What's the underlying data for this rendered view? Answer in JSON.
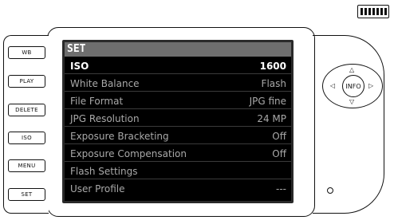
{
  "side_buttons": [
    {
      "label": "WB"
    },
    {
      "label": "PLAY"
    },
    {
      "label": "DELETE"
    },
    {
      "label": "ISO"
    },
    {
      "label": "MENU"
    },
    {
      "label": "SET"
    }
  ],
  "screen": {
    "title": "SET",
    "rows": [
      {
        "label": "ISO",
        "value": "1600",
        "selected": true
      },
      {
        "label": "White Balance",
        "value": "Flash"
      },
      {
        "label": "File Format",
        "value": "JPG fine"
      },
      {
        "label": "JPG Resolution",
        "value": "24 MP"
      },
      {
        "label": "Exposure Bracketing",
        "value": "Off"
      },
      {
        "label": "Exposure Compensation",
        "value": "Off"
      },
      {
        "label": "Flash Settings",
        "value": ""
      },
      {
        "label": "User Profile",
        "value": "---"
      }
    ]
  },
  "nav": {
    "center_label": "INFO",
    "up": "△",
    "down": "▽",
    "left": "◁",
    "right": "▷"
  },
  "battery": {
    "level": 1.0
  }
}
